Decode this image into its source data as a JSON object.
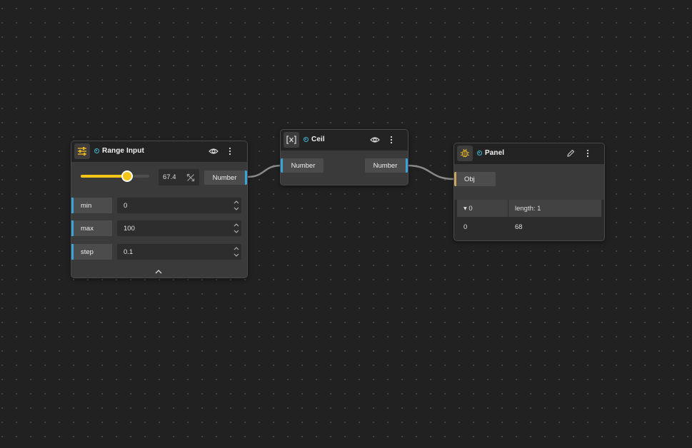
{
  "colors": {
    "canvas_bg": "#212121",
    "node_bg": "#3a3a3a",
    "header_bg": "#232323",
    "number_port": "#3aa3d9",
    "object_port": "#caa461",
    "slider_accent": "#f5c518",
    "status_dot": "#43b6cf"
  },
  "range_node": {
    "title": "Range Input",
    "icon": "sliders-icon",
    "slider_value": 67.4,
    "value_display": "67.4",
    "output_port": "Number",
    "params": [
      {
        "label": "min",
        "value": "0"
      },
      {
        "label": "max",
        "value": "100"
      },
      {
        "label": "step",
        "value": "0.1"
      }
    ]
  },
  "ceil_node": {
    "title": "Ceil",
    "icon": "function-icon",
    "input_port": "Number",
    "output_port": "Number"
  },
  "panel_node": {
    "title": "Panel",
    "icon": "bug-icon",
    "input_port": "Obj",
    "table": {
      "header": {
        "key": "▾ 0",
        "value": "length: 1"
      },
      "rows": [
        {
          "key": "0",
          "value": "68"
        }
      ]
    }
  }
}
